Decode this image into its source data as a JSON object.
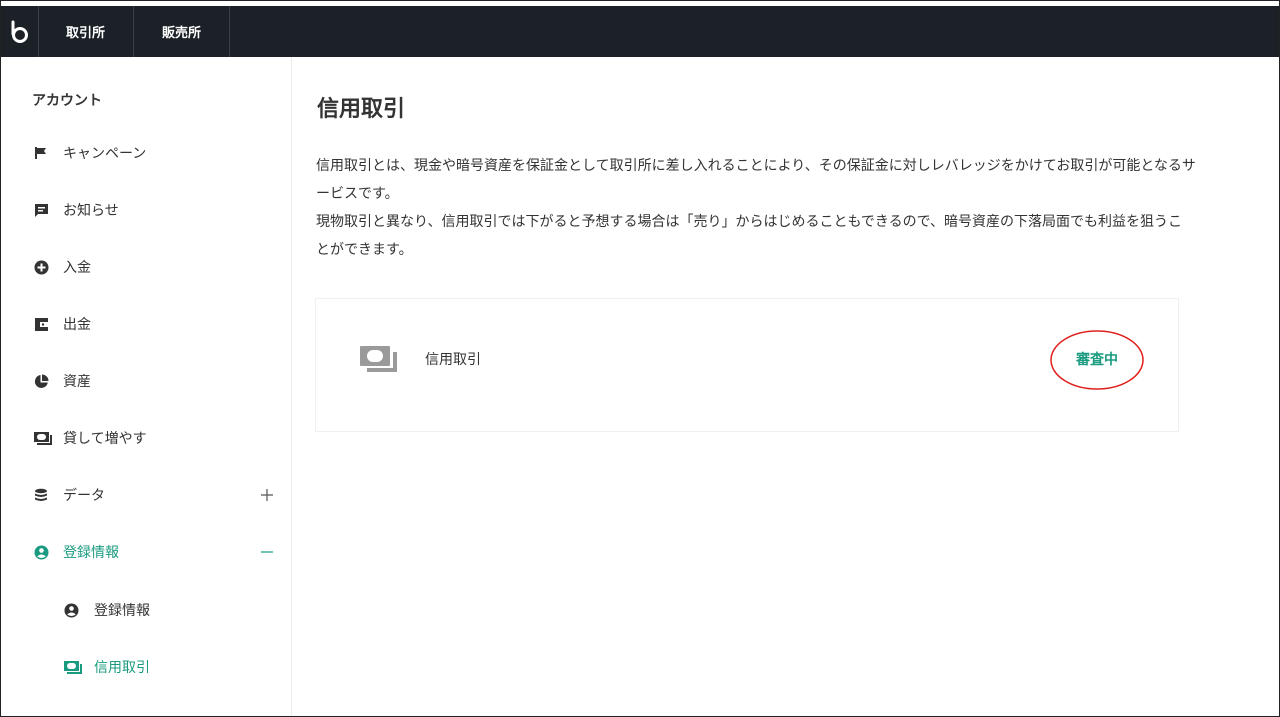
{
  "header": {
    "logo_icon": "bitbank-logo-icon",
    "tabs": [
      {
        "label": "取引所"
      },
      {
        "label": "販売所"
      }
    ]
  },
  "sidebar": {
    "heading": "アカウント",
    "items": [
      {
        "label": "キャンペーン",
        "icon": "flag-icon"
      },
      {
        "label": "お知らせ",
        "icon": "message-icon"
      },
      {
        "label": "入金",
        "icon": "plus-circle-icon"
      },
      {
        "label": "出金",
        "icon": "wallet-icon"
      },
      {
        "label": "資産",
        "icon": "pie-chart-icon"
      },
      {
        "label": "貸して増やす",
        "icon": "money-icon"
      },
      {
        "label": "データ",
        "icon": "database-icon",
        "expander": "+"
      },
      {
        "label": "登録情報",
        "icon": "user-circle-icon",
        "expander": "−"
      }
    ],
    "sub_items": [
      {
        "label": "登録情報",
        "icon": "user-circle-icon"
      },
      {
        "label": "信用取引",
        "icon": "money-icon"
      }
    ],
    "active_color": "#1a9b80"
  },
  "main": {
    "title": "信用取引",
    "description": [
      "信用取引とは、現金や暗号資産を保証金として取引所に差し入れることにより、その保証金に対しレバレッジをかけてお取引が可能となるサービスです。",
      "現物取引と異なり、信用取引では下がると予想する場合は「売り」からはじめることもできるので、暗号資産の下落局面でも利益を狙うことができます。"
    ],
    "card": {
      "icon": "money-icon",
      "label": "信用取引",
      "status": "審査中",
      "status_color": "#1a9b80",
      "annotation_color": "#e0201c"
    }
  }
}
